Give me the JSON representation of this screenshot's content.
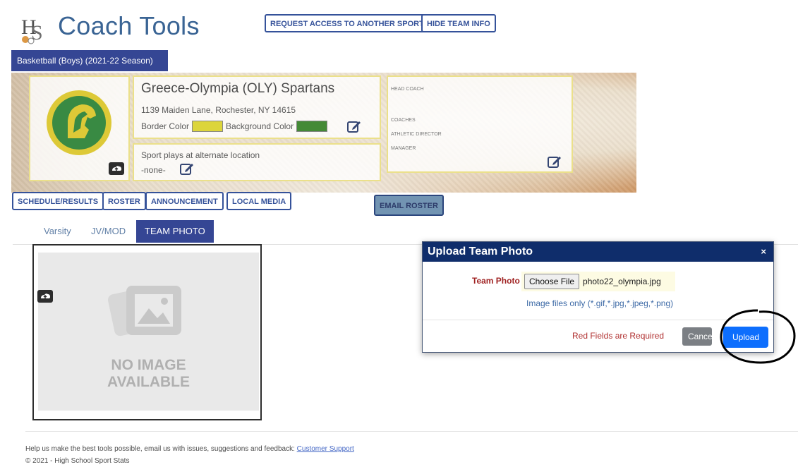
{
  "header": {
    "logo_alt": "HSS",
    "title": "Coach Tools",
    "request_access_label": "REQUEST ACCESS TO ANOTHER SPORT",
    "hide_team_info_label": "HIDE TEAM INFO"
  },
  "sport_tab": "Basketball (Boys) (2021-22 Season)",
  "team": {
    "name": "Greece-Olympia (OLY) Spartans",
    "address": "1139 Maiden Lane, Rochester, NY 14615",
    "border_color_label": "Border Color",
    "border_color": "#d8d020",
    "background_color_label": "Background Color",
    "background_color": "#2b7a1b",
    "alternate_location_label": "Sport plays at alternate location",
    "alternate_location_value": "-none-",
    "logo_colors": {
      "ring": "#d9c21c",
      "inner": "#1e7a2a"
    }
  },
  "staff": {
    "head_coach_label": "HEAD COACH",
    "coaches_label": "COACHES",
    "athletic_director_label": "ATHLETIC DIRECTOR",
    "manager_label": "MANAGER"
  },
  "action_tabs": [
    "SCHEDULE/RESULTS",
    "ROSTER",
    "ANNOUNCEMENT",
    "LOCAL MEDIA"
  ],
  "email_roster_label": "EMAIL ROSTER",
  "sub_tabs": [
    "Varsity",
    "JV/MOD",
    "TEAM PHOTO"
  ],
  "active_sub_tab": "TEAM PHOTO",
  "photo": {
    "no_image_line1": "NO IMAGE",
    "no_image_line2": "AVAILABLE"
  },
  "modal": {
    "title": "Upload Team Photo",
    "close": "×",
    "field_label": "Team Photo",
    "choose_file_label": "Choose File",
    "file_name": "photo22_olympia.jpg",
    "hint": "Image files only (*.gif,*.jpg,*.jpeg,*.png)",
    "required_text": "Red Fields are Required",
    "cancel_label": "Cancel",
    "upload_label": "Upload"
  },
  "footer": {
    "feedback_text": "Help us make the best tools possible, email us with issues, suggestions and feedback:",
    "support_link": "Customer Support",
    "copyright": "© 2021 - High School Sport Stats"
  },
  "colors": {
    "brand_navy": "#1a2d86",
    "modal_header": "#0f2d6b",
    "primary_blue": "#0d6efd"
  }
}
